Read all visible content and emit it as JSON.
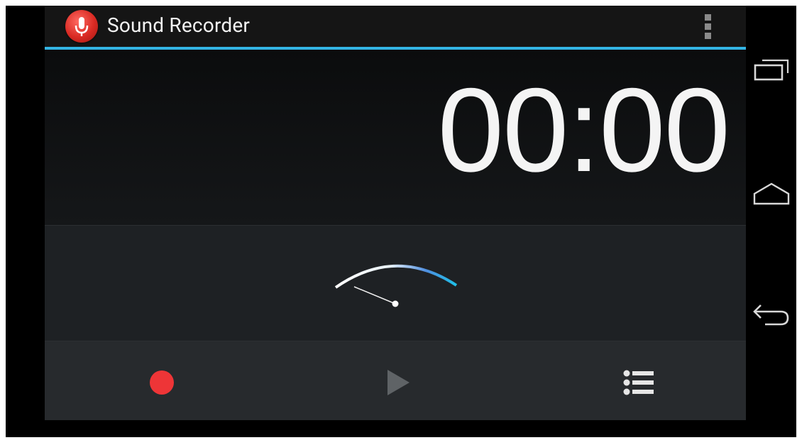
{
  "app": {
    "title": "Sound Recorder",
    "icon": "microphone-icon"
  },
  "action_bar": {
    "overflow_icon": "overflow-menu-icon",
    "accent_color": "#33b5e5"
  },
  "timer": {
    "value": "00:00"
  },
  "level_meter": {
    "icon": "vu-meter-gauge",
    "gradient_colors": [
      "#ffffff",
      "#33b5e5"
    ]
  },
  "controls": {
    "record": {
      "icon": "record-icon",
      "color": "#ee3537",
      "enabled": true
    },
    "play": {
      "icon": "play-icon",
      "enabled": false
    },
    "list": {
      "icon": "recordings-list-icon",
      "enabled": true
    }
  },
  "navigation": {
    "recents": "recent-apps-icon",
    "home": "home-icon",
    "back": "back-icon"
  }
}
